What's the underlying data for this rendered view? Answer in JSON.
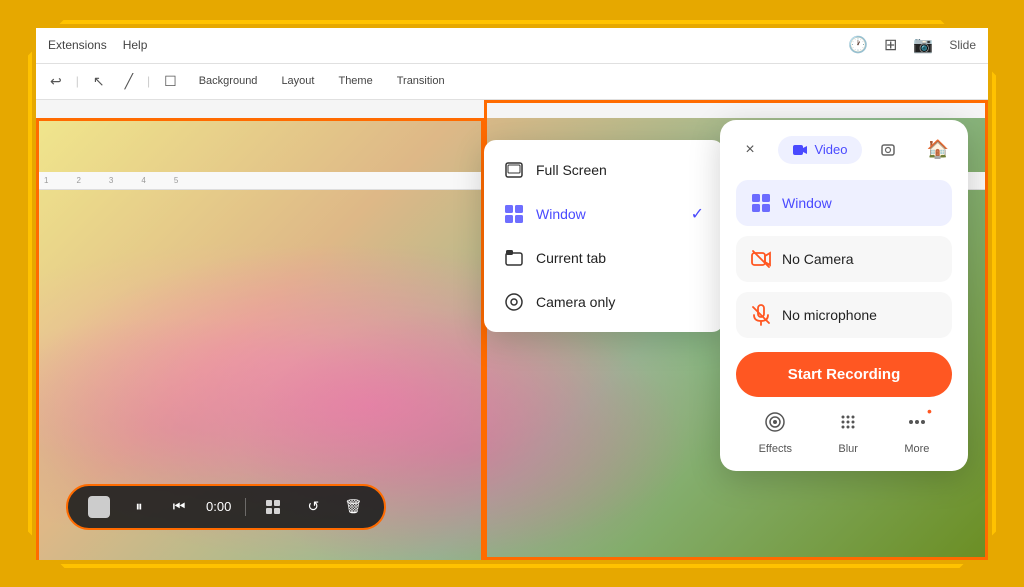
{
  "app": {
    "title": "Google Slides"
  },
  "topbar": {
    "menu_items": [
      "Extensions",
      "Help"
    ]
  },
  "toolbar": {
    "items": [
      "Background",
      "Layout",
      "Theme",
      "Transition"
    ]
  },
  "ruler": {
    "marks": [
      "1",
      "2",
      "3",
      "4",
      "5"
    ]
  },
  "dropdown": {
    "items": [
      {
        "id": "full-screen",
        "label": "Full Screen",
        "icon": "🖥",
        "selected": false
      },
      {
        "id": "window",
        "label": "Window",
        "icon": "⊞",
        "selected": true
      },
      {
        "id": "current-tab",
        "label": "Current tab",
        "icon": "⬜",
        "selected": false
      },
      {
        "id": "camera-only",
        "label": "Camera only",
        "icon": "◎",
        "selected": false
      }
    ]
  },
  "right_panel": {
    "close_label": "×",
    "tab_video_label": "Video",
    "tab_screenshot_label": "Screenshot",
    "home_icon": "🏠",
    "options": [
      {
        "id": "window",
        "label": "Window",
        "active": true
      },
      {
        "id": "no-camera",
        "label": "No Camera",
        "active": false
      },
      {
        "id": "no-microphone",
        "label": "No microphone",
        "active": false
      }
    ],
    "start_recording_label": "Start Recording",
    "footer": [
      {
        "id": "effects",
        "label": "Effects",
        "icon": "◎"
      },
      {
        "id": "blur",
        "label": "Blur",
        "icon": "⠿"
      },
      {
        "id": "more",
        "label": "More",
        "icon": "···"
      }
    ]
  },
  "media_controls": {
    "stop_label": "",
    "pause_label": "⏸",
    "rewind_label": "⏮",
    "time": "0:00",
    "grid_label": "⊞",
    "refresh_label": "↺",
    "delete_label": "🗑"
  },
  "colors": {
    "accent_orange": "#FF5722",
    "border_orange": "#FF6B00",
    "bg_yellow": "#E6A800",
    "selected_blue": "#4A4AFF",
    "selected_bg": "#EEF0FF"
  }
}
